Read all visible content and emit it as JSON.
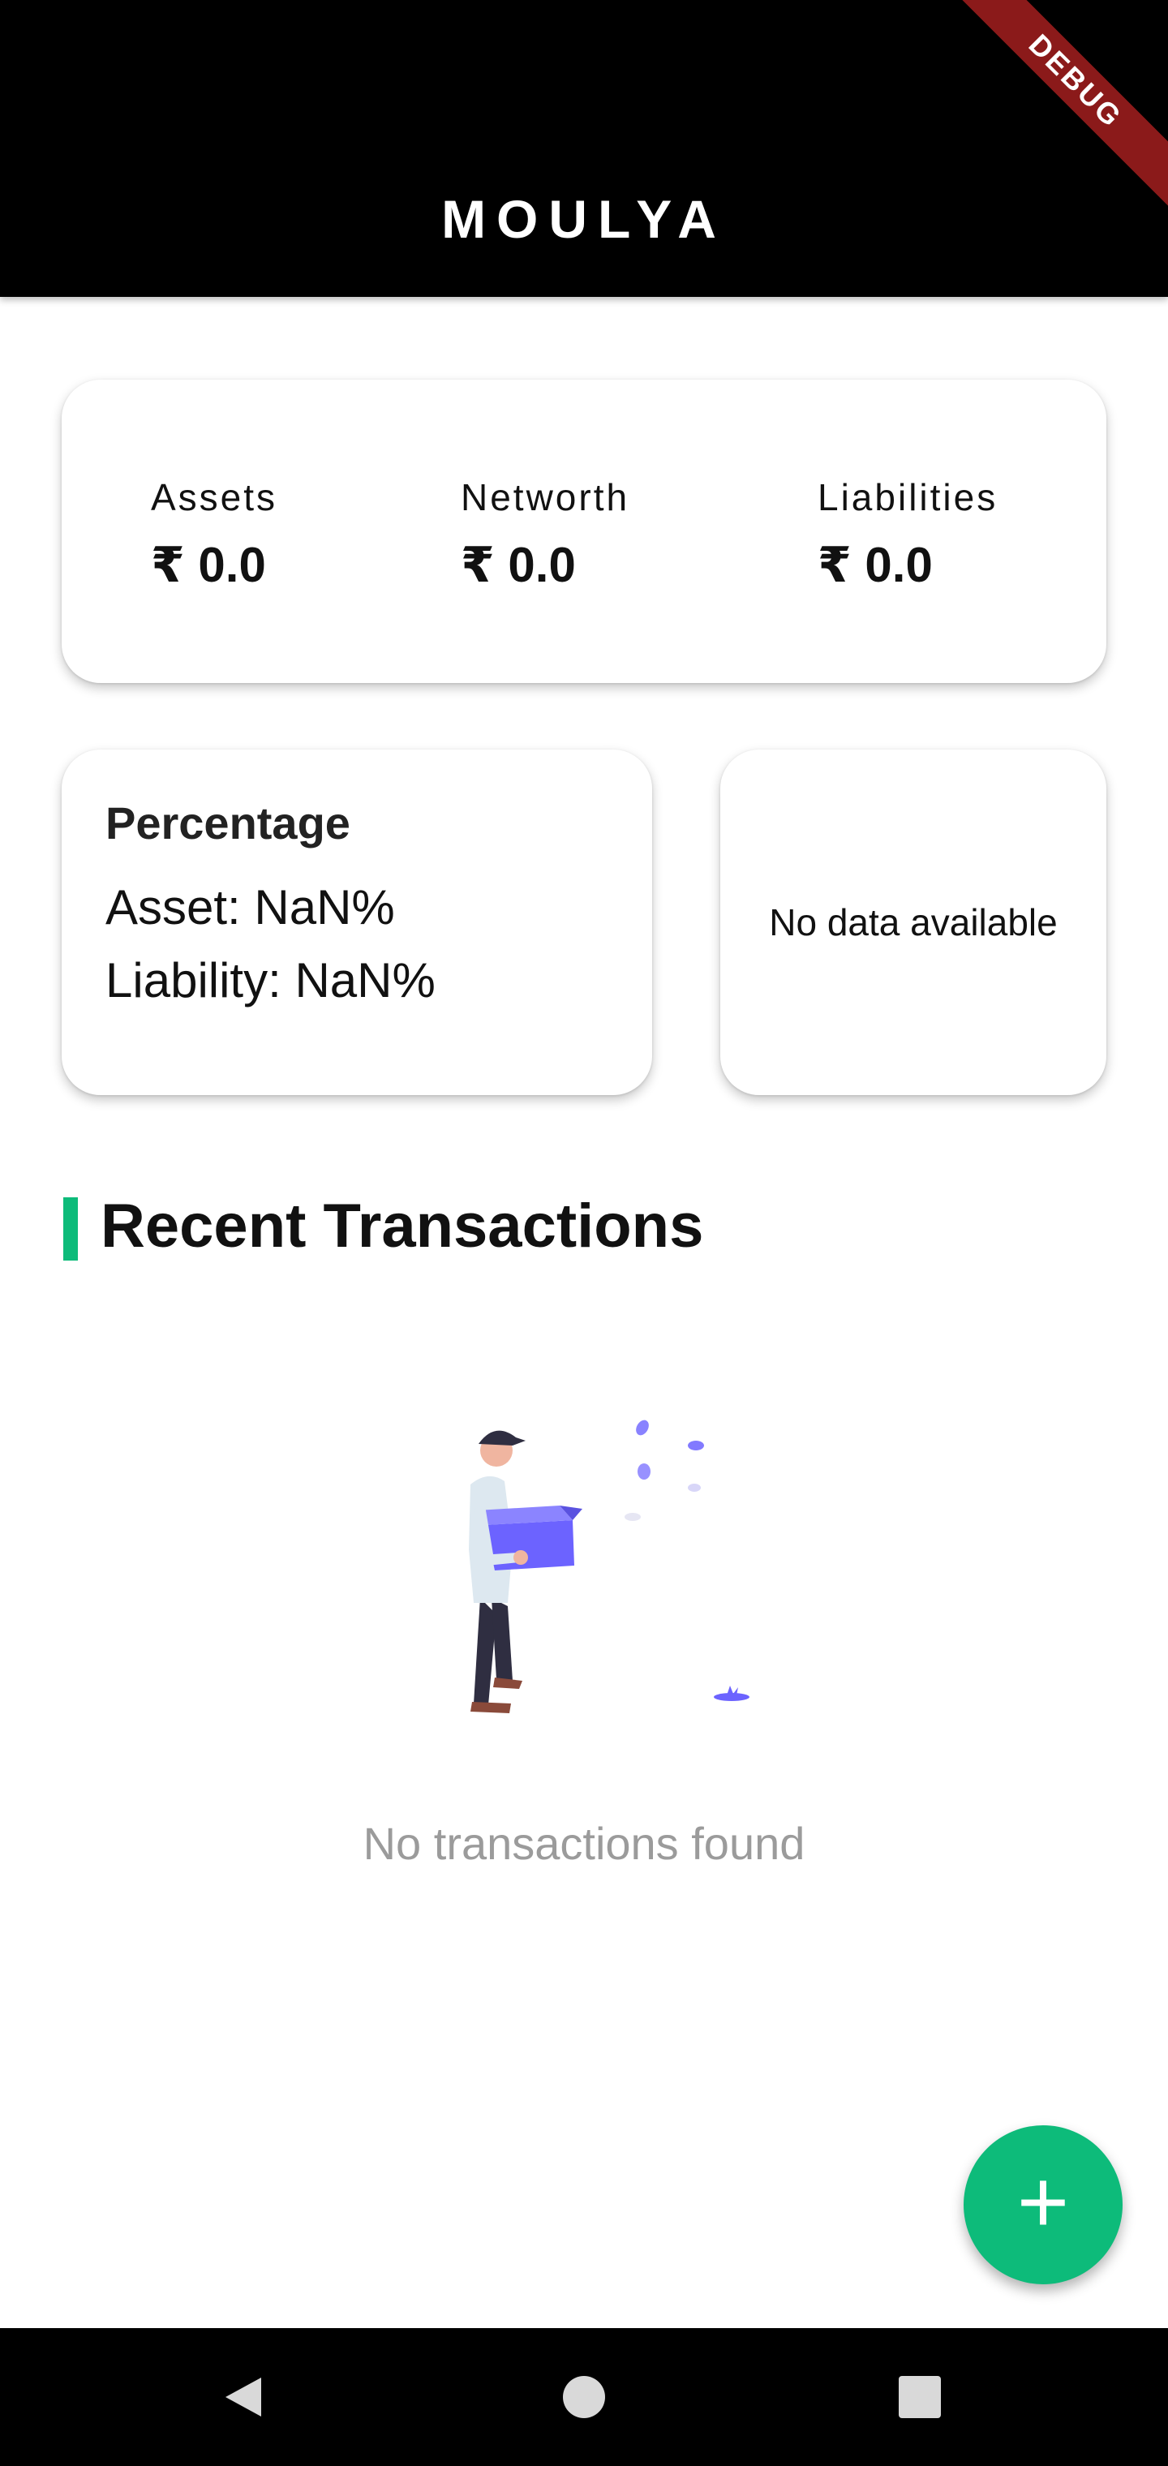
{
  "app_bar": {
    "title": "MOULYA",
    "debug_banner": "DEBUG"
  },
  "summary": {
    "assets": {
      "label": "Assets",
      "value": "₹ 0.0"
    },
    "networth": {
      "label": "Networth",
      "value": "₹ 0.0"
    },
    "liabilities": {
      "label": "Liabilities",
      "value": "₹ 0.0"
    }
  },
  "percentage": {
    "title": "Percentage",
    "asset_line": "Asset: NaN%",
    "liability_line": "Liability: NaN%"
  },
  "chart_panel": {
    "message": "No data available"
  },
  "recent_transactions": {
    "title": "Recent Transactions",
    "empty_message": "No transactions found"
  },
  "fab": {
    "icon": "plus-icon",
    "symbol": "+"
  },
  "nav": {
    "back": "back-icon",
    "home": "home-icon",
    "recents": "recents-icon"
  },
  "colors": {
    "accent": "#0dbb7a",
    "app_bar": "#000000",
    "illustration_purple": "#6c63ff"
  }
}
